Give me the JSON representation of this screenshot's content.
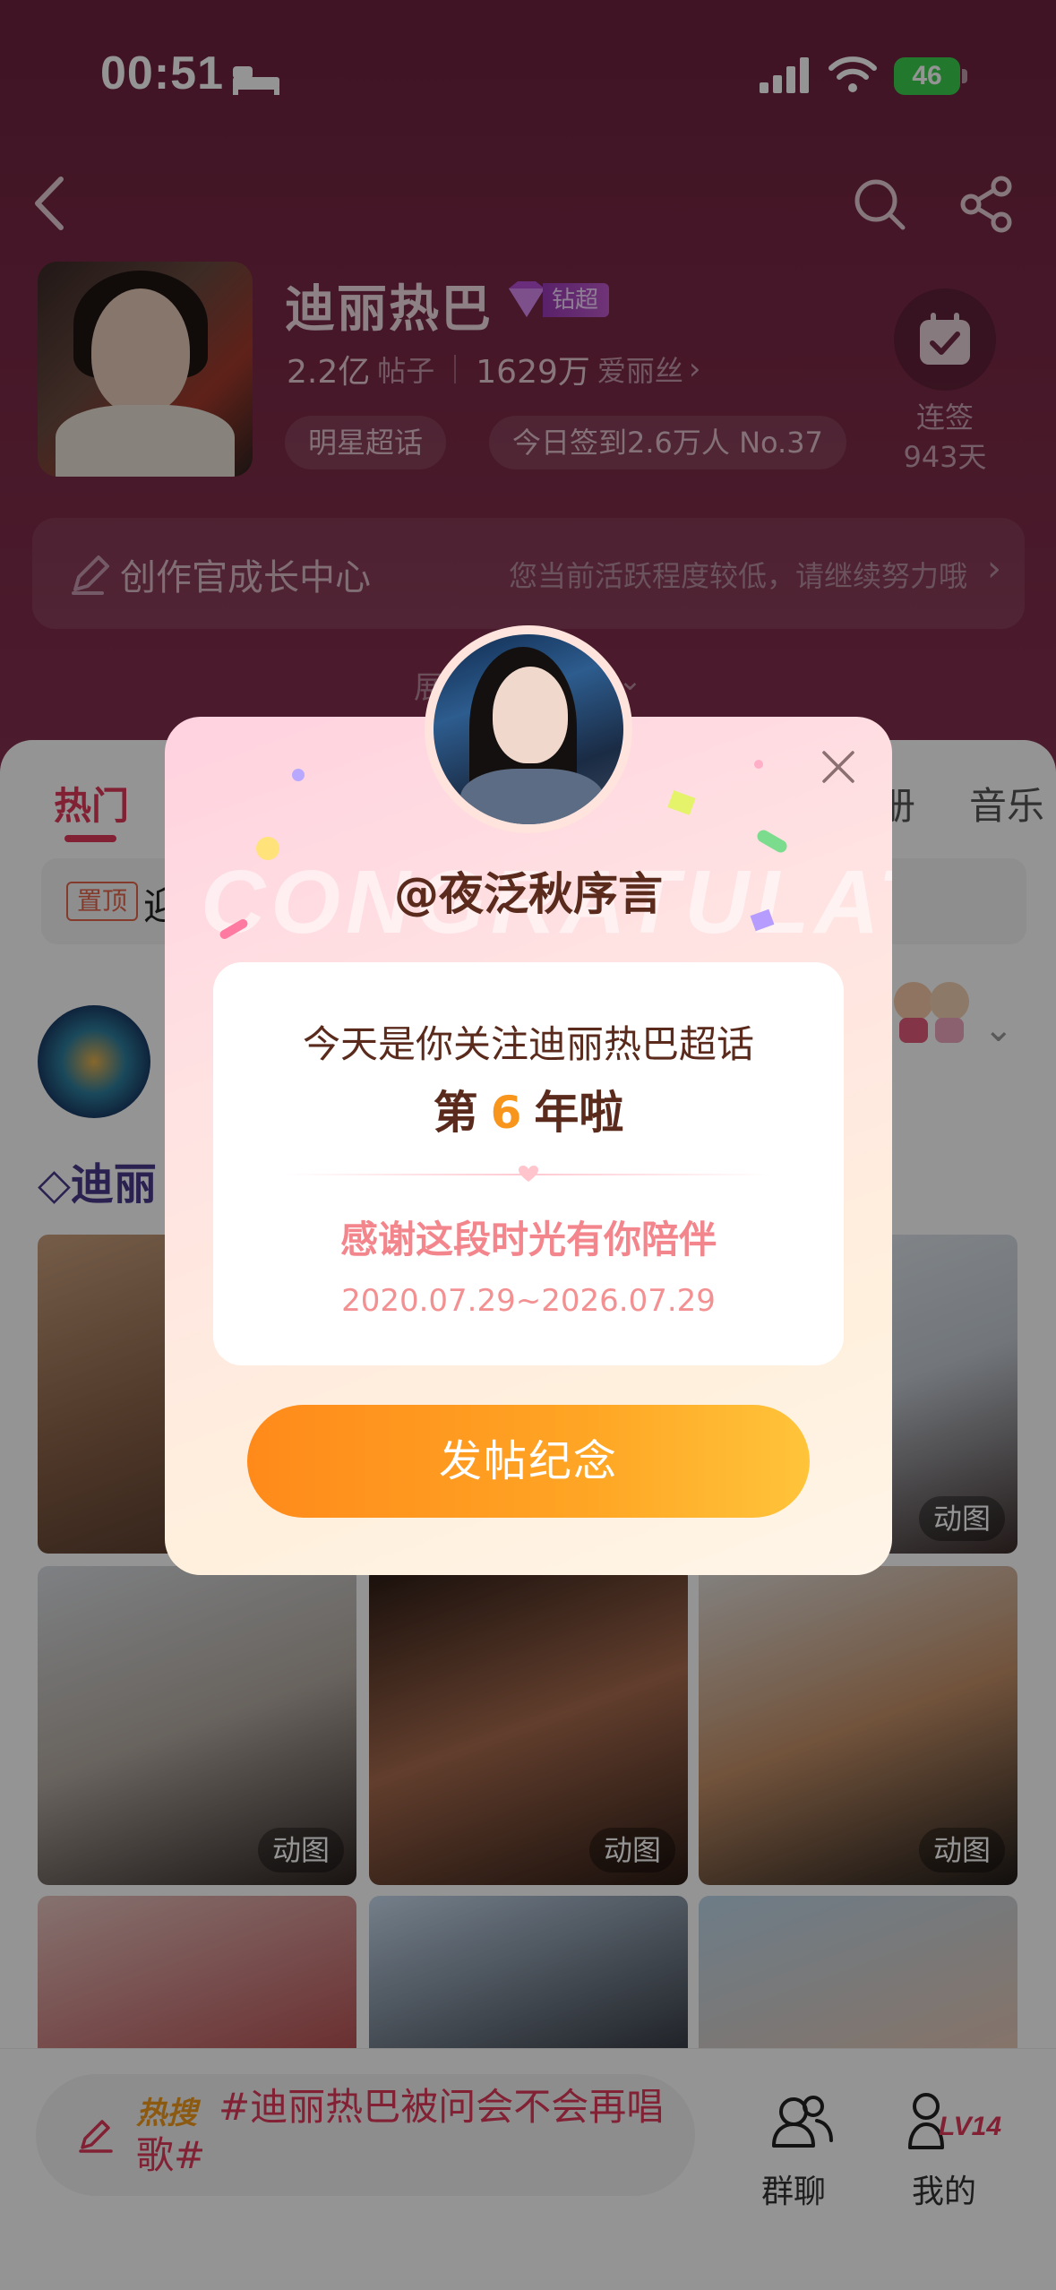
{
  "status_bar": {
    "time": "00:51",
    "battery": "46"
  },
  "header": {
    "star_name": "迪丽热巴",
    "tier_badge": "钻超",
    "posts_count": "2.2亿",
    "posts_unit": "帖子",
    "fans_count": "1629万",
    "fans_unit": "爱丽丝",
    "category_pill": "明星超话",
    "checkin_pill": "今日签到2.6万人 No.37",
    "signin_label_1": "连签",
    "signin_label_2": "943天",
    "growth_title": "创作官成长中心",
    "growth_hint": "您当前活跃程度较低，请继续努力哦",
    "expand_text": "展"
  },
  "tabs": {
    "hot": "热门",
    "album": "册",
    "music": "音乐"
  },
  "pinned": {
    "tag": "置顶",
    "text": "迎"
  },
  "post": {
    "title_prefix": "迪丽"
  },
  "tiles": {
    "gif_label": "动图"
  },
  "bottom_bar": {
    "hot_label": "热搜",
    "hot_topic": "#迪丽热巴被问会不会再唱歌#",
    "group_chat": "群聊",
    "me": "我的",
    "level": "LV14"
  },
  "popup": {
    "watermark": "CONGRATULATE",
    "username": "@夜泛秋序言",
    "line1": "今天是你关注迪丽热巴超话",
    "line2_prefix": "第",
    "line2_years": "6",
    "line2_suffix": "年啦",
    "thanks": "感谢这段时光有你陪伴",
    "dates": "2020.07.29~2026.07.29",
    "button": "发帖纪念"
  },
  "colors": {
    "accent": "#e0375a",
    "button_start": "#ff8a1a",
    "button_end": "#ffc43a",
    "years_highlight": "#f7951d"
  }
}
